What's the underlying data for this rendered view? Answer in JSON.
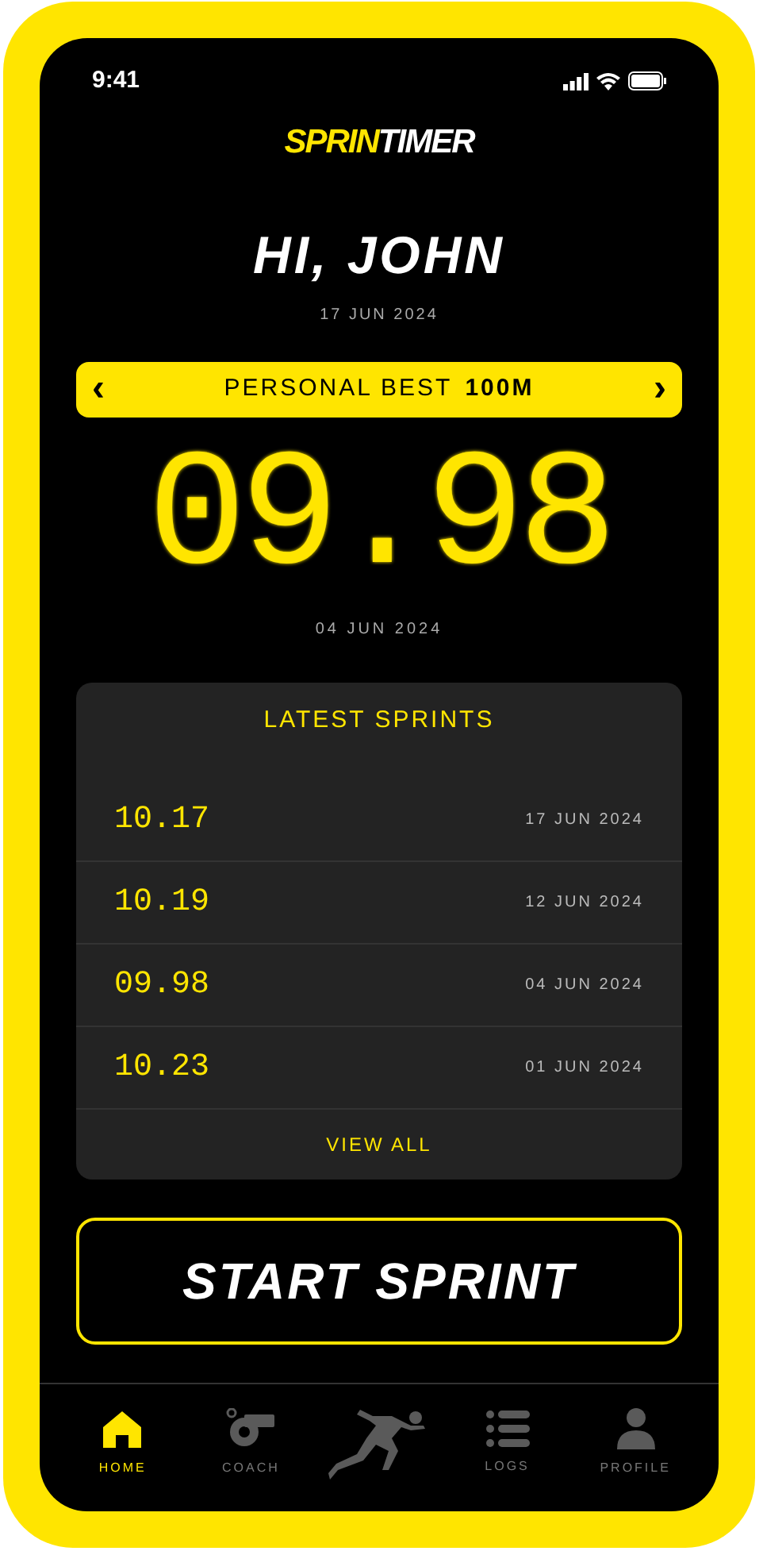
{
  "status_bar": {
    "time": "9:41"
  },
  "logo": {
    "part_1": "SPRIN",
    "part_2": "TIMER"
  },
  "greeting": {
    "title": "HI, JOHN",
    "date": "17 JUN 2024"
  },
  "personal_best": {
    "label": "PERSONAL BEST",
    "distance": "100M",
    "prev": "‹",
    "next": "›",
    "time": "09.98",
    "date": "04 JUN 2024"
  },
  "latest_sprints": {
    "title": "LATEST SPRINTS",
    "rows": [
      {
        "time": "10.17",
        "date": "17 JUN 2024"
      },
      {
        "time": "10.19",
        "date": "12 JUN 2024"
      },
      {
        "time": "09.98",
        "date": "04 JUN 2024"
      },
      {
        "time": "10.23",
        "date": "01 JUN 2024"
      }
    ],
    "view_all": "VIEW ALL"
  },
  "start_button": "START SPRINT",
  "nav": [
    {
      "kind": "home",
      "label": "HOME",
      "selected": true
    },
    {
      "kind": "coach",
      "label": "COACH",
      "selected": false
    },
    {
      "kind": "sprint",
      "selected": false
    },
    {
      "kind": "logs",
      "label": "LOGS",
      "selected": false
    },
    {
      "kind": "profile",
      "label": "PROFILE",
      "selected": false
    }
  ]
}
